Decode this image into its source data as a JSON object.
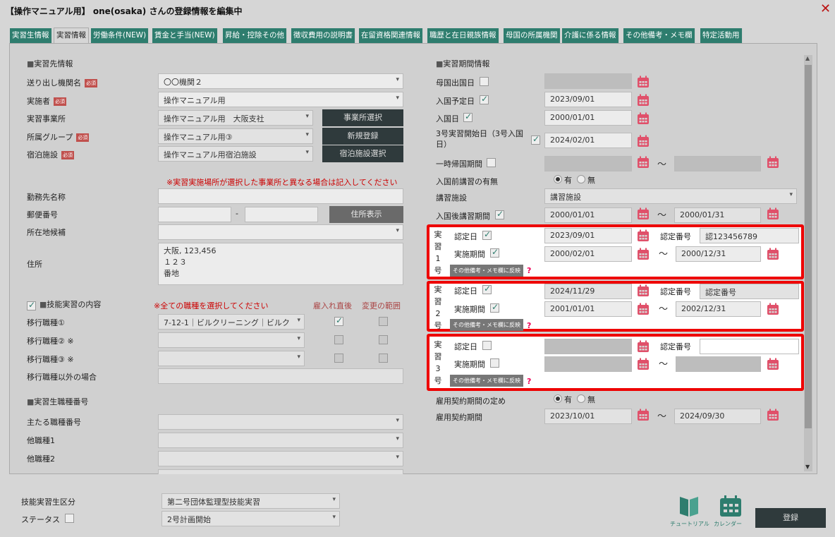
{
  "window": {
    "title": "【操作マニュアル用】 one(osaka) さんの登録情報を編集中",
    "close": "✕"
  },
  "tabs": [
    "実習生情報",
    "実習情報",
    "労働条件(NEW)",
    "賃金と手当(NEW)",
    "昇給・控除その他",
    "徴収費用の説明書",
    "在留資格関連情報",
    "職歴と在日親族情報",
    "母国の所属機関",
    "介護に係る情報",
    "その他備考・メモ欄",
    "特定活動用"
  ],
  "left": {
    "section1": "実習先情報",
    "req": "必須",
    "sending_org": {
      "label": "送り出し機関名",
      "value": "〇〇機関２"
    },
    "implementer": {
      "label": "実施者",
      "value": "操作マニュアル用"
    },
    "office": {
      "label": "実習事業所",
      "value": "操作マニュアル用　大阪支社",
      "btn": "事業所選択"
    },
    "group": {
      "label": "所属グループ",
      "value": "操作マニュアル用③",
      "btn": "新規登録"
    },
    "lodging": {
      "label": "宿泊施設",
      "value": "操作マニュアル用宿泊施設",
      "btn": "宿泊施設選択"
    },
    "note": "※実習実施場所が選択した事業所と異なる場合は記入してください",
    "workplace": {
      "label": "勤務先名称",
      "value": ""
    },
    "postal": {
      "label": "郵便番号",
      "sep": "-",
      "btn": "住所表示"
    },
    "pref": {
      "label": "所在地候補",
      "value": ""
    },
    "address": {
      "label": "住所",
      "lines": [
        "大阪, 123,456",
        "１２３",
        "番地"
      ]
    },
    "section2": "技能実習の内容",
    "select_all": "※全ての職種を選択してください",
    "col1": "雇入れ直後",
    "col2": "変更の範囲",
    "job1": {
      "label": "移行職種①",
      "value": "7-12-1｜ビルクリーニング｜ビルク"
    },
    "job2": {
      "label": "移行職種② ※",
      "value": ""
    },
    "job3": {
      "label": "移行職種③ ※",
      "value": ""
    },
    "job_other": {
      "label": "移行職種以外の場合",
      "value": ""
    },
    "section3": "実習生職種番号",
    "main_no": {
      "label": "主たる職種番号"
    },
    "other1": {
      "label": "他職種1"
    },
    "other2": {
      "label": "他職種2"
    }
  },
  "right": {
    "section": "実習期間情報",
    "depart": {
      "label": "母国出国日",
      "value": ""
    },
    "entry_plan": {
      "label": "入国予定日",
      "value": "2023/09/01"
    },
    "entry": {
      "label": "入国日",
      "value": "2000/01/01"
    },
    "start3": {
      "label": "3号実習開始日（3号入国日）",
      "value": "2024/02/01"
    },
    "temp_return": {
      "label": "一時帰国期間"
    },
    "pre_training": {
      "label": "入国前講習の有無",
      "yes": "有",
      "no": "無"
    },
    "facility": {
      "label": "講習施設",
      "value": "講習施設"
    },
    "post_training": {
      "label": "入国後講習期間",
      "from": "2000/01/01",
      "to": "2000/01/31"
    },
    "tilde": "〜",
    "g1": {
      "vert": [
        "実",
        "習",
        "1",
        "号"
      ],
      "cert_label": "認定日",
      "cert_date": "2023/09/01",
      "no_label": "認定番号",
      "no_value": "認123456789",
      "period_label": "実施期間",
      "from": "2000/02/01",
      "to": "2000/12/31",
      "memo": "その他備考・メモ欄に反映",
      "q": "?"
    },
    "g2": {
      "vert": [
        "実",
        "習",
        "2",
        "号"
      ],
      "cert_label": "認定日",
      "cert_date": "2024/11/29",
      "no_label": "認定番号",
      "no_value": "認定番号",
      "period_label": "実施期間",
      "from": "2001/01/01",
      "to": "2002/12/31",
      "memo": "その他備考・メモ欄に反映",
      "q": "?"
    },
    "g3": {
      "vert": [
        "実",
        "習",
        "3",
        "号"
      ],
      "cert_label": "認定日",
      "no_label": "認定番号",
      "period_label": "実施期間",
      "memo": "その他備考・メモ欄に反映",
      "q": "?"
    },
    "contract_def": {
      "label": "雇用契約期間の定め",
      "yes": "有",
      "no": "無"
    },
    "contract": {
      "label": "雇用契約期間",
      "from": "2023/10/01",
      "to": "2024/09/30"
    }
  },
  "footer": {
    "category": {
      "label": "技能実習生区分",
      "value": "第二号団体監理型技能実習"
    },
    "status": {
      "label": "ステータス",
      "value": "2号計画開始"
    },
    "tutorial": "チュートリアル",
    "calendar": "カレンダー",
    "register": "登録"
  }
}
